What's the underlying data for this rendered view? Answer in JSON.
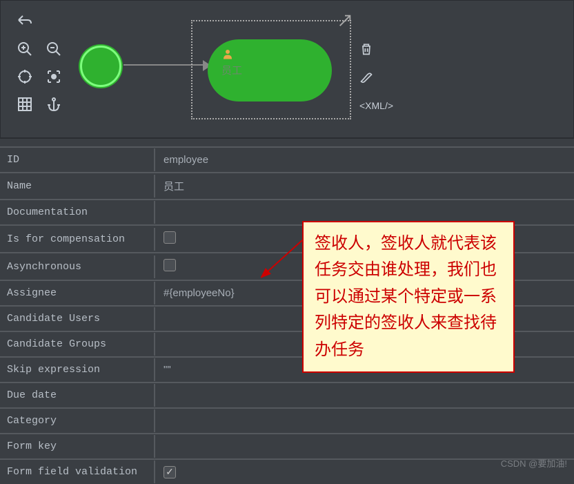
{
  "canvas": {
    "task_label": "员工",
    "xml_label": "<XML/>"
  },
  "properties": {
    "id": {
      "label": "ID",
      "value": "employee"
    },
    "name": {
      "label": "Name",
      "value": "员工"
    },
    "documentation": {
      "label": "Documentation",
      "value": ""
    },
    "compensation": {
      "label": "Is for compensation",
      "checked": false
    },
    "asynchronous": {
      "label": "Asynchronous",
      "checked": false
    },
    "assignee": {
      "label": "Assignee",
      "value": "#{employeeNo}"
    },
    "candidate_users": {
      "label": "Candidate Users",
      "value": ""
    },
    "candidate_groups": {
      "label": "Candidate Groups",
      "value": ""
    },
    "skip_expression": {
      "label": "Skip expression",
      "value": "\"\""
    },
    "due_date": {
      "label": "Due date",
      "value": ""
    },
    "category": {
      "label": "Category",
      "value": ""
    },
    "form_key": {
      "label": "Form key",
      "value": ""
    },
    "form_validation": {
      "label": "Form field validation",
      "checked": true
    }
  },
  "annotation": {
    "text": "签收人，签收人就代表该任务交由谁处理，我们也可以通过某个特定或一系列特定的签收人来查找待办任务"
  },
  "watermark": "CSDN @要加油!"
}
